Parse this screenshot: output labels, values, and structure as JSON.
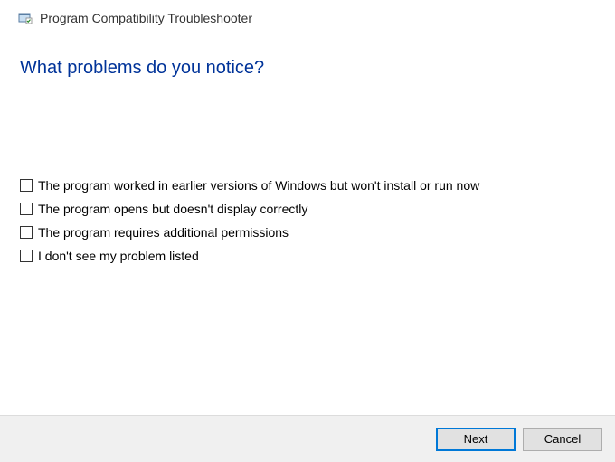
{
  "header": {
    "title": "Program Compatibility Troubleshooter"
  },
  "main": {
    "heading": "What problems do you notice?"
  },
  "options": [
    {
      "label": "The program worked in earlier versions of Windows but won't install or run now"
    },
    {
      "label": "The program opens but doesn't display correctly"
    },
    {
      "label": "The program requires additional permissions"
    },
    {
      "label": "I don't see my problem listed"
    }
  ],
  "footer": {
    "next_label": "Next",
    "cancel_label": "Cancel"
  }
}
